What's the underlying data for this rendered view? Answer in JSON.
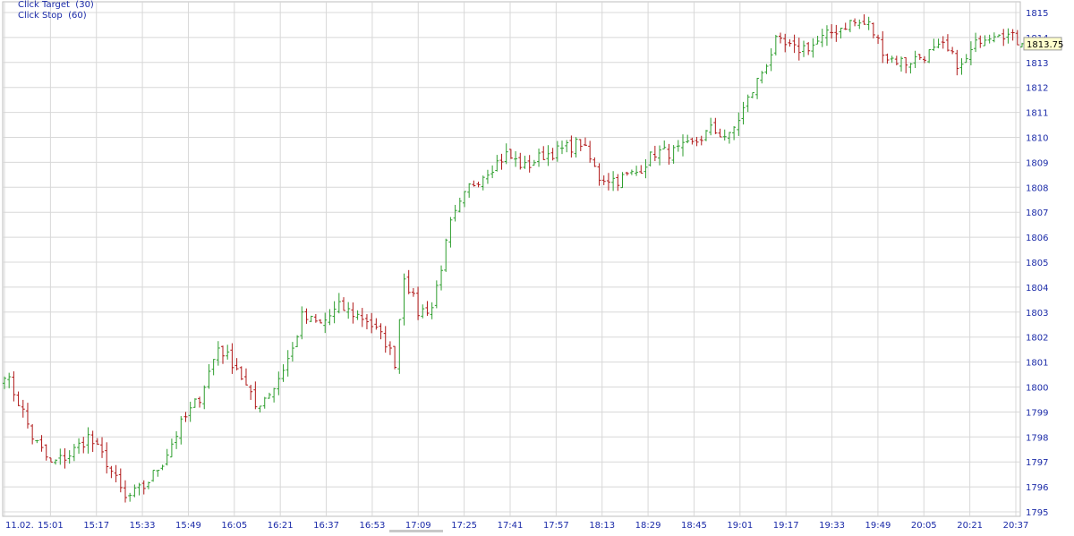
{
  "controls": {
    "click_target": "Click Target  (30)",
    "click_stop": "Click Stop  (60)"
  },
  "last_price_label": "1813.75",
  "colors": {
    "up": "#2e9e2e",
    "down": "#b01818",
    "grid": "#d8d8d8",
    "axis_text": "#1a2aa8",
    "price_tag_bg": "#ffffcc"
  },
  "chart_data": {
    "type": "ohlc",
    "x_tick_labels": [
      "11.02.",
      "15:01",
      "15:17",
      "15:33",
      "15:49",
      "16:05",
      "16:21",
      "16:37",
      "16:53",
      "17:09",
      "17:25",
      "17:41",
      "17:57",
      "18:13",
      "18:29",
      "18:45",
      "19:01",
      "19:17",
      "19:33",
      "19:49",
      "20:05",
      "20:21",
      "20:37"
    ],
    "y_tick_labels": [
      "1795",
      "1796",
      "1797",
      "1798",
      "1799",
      "1800",
      "1801",
      "1802",
      "1803",
      "1804",
      "1805",
      "1806",
      "1807",
      "1808",
      "1809",
      "1810",
      "1811",
      "1812",
      "1813",
      "1814",
      "1815"
    ],
    "ylim": [
      1795,
      1815.5
    ],
    "grid": true,
    "last_price": 1813.75,
    "close_path": [
      [
        0,
        1800.6
      ],
      [
        4,
        1799.0
      ],
      [
        6,
        1798.0
      ],
      [
        10,
        1796.9
      ],
      [
        14,
        1797.3
      ],
      [
        18,
        1798.0
      ],
      [
        22,
        1797.0
      ],
      [
        26,
        1795.5
      ],
      [
        30,
        1796.0
      ],
      [
        34,
        1797.0
      ],
      [
        38,
        1798.5
      ],
      [
        42,
        1799.6
      ],
      [
        46,
        1801.6
      ],
      [
        50,
        1800.8
      ],
      [
        54,
        1799.2
      ],
      [
        58,
        1800.0
      ],
      [
        62,
        1801.5
      ],
      [
        64,
        1802.8
      ],
      [
        68,
        1802.5
      ],
      [
        72,
        1803.2
      ],
      [
        78,
        1802.7
      ],
      [
        82,
        1801.8
      ],
      [
        84,
        1801.0
      ],
      [
        86,
        1804.5
      ],
      [
        89,
        1803.0
      ],
      [
        92,
        1803.2
      ],
      [
        96,
        1806.5
      ],
      [
        100,
        1808.0
      ],
      [
        104,
        1808.7
      ],
      [
        108,
        1809.3
      ],
      [
        112,
        1808.8
      ],
      [
        116,
        1809.3
      ],
      [
        120,
        1809.5
      ],
      [
        124,
        1809.8
      ],
      [
        128,
        1808.4
      ],
      [
        132,
        1808.3
      ],
      [
        136,
        1808.6
      ],
      [
        140,
        1809.4
      ],
      [
        144,
        1809.4
      ],
      [
        148,
        1809.7
      ],
      [
        152,
        1810.3
      ],
      [
        156,
        1810.0
      ],
      [
        160,
        1811.5
      ],
      [
        164,
        1813.0
      ],
      [
        166,
        1813.8
      ],
      [
        170,
        1813.5
      ],
      [
        174,
        1813.7
      ],
      [
        178,
        1814.2
      ],
      [
        182,
        1814.6
      ],
      [
        186,
        1814.5
      ],
      [
        190,
        1813.2
      ],
      [
        194,
        1813.0
      ],
      [
        198,
        1813.3
      ],
      [
        202,
        1813.6
      ],
      [
        206,
        1812.8
      ],
      [
        210,
        1814.0
      ],
      [
        214,
        1814.3
      ],
      [
        219,
        1813.75
      ]
    ]
  }
}
